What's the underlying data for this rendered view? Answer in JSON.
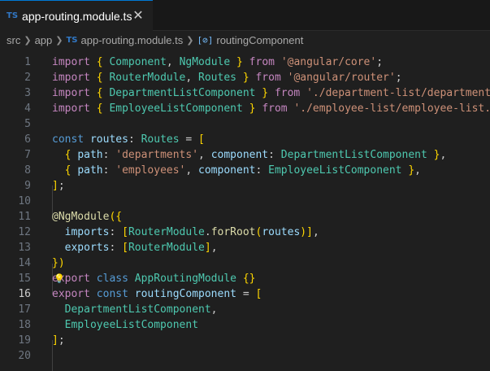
{
  "tab": {
    "badge": "TS",
    "title": "app-routing.module.ts",
    "close": "✕"
  },
  "breadcrumb": {
    "items": [
      "src",
      "app",
      "app-routing.module.ts",
      "routingComponent"
    ],
    "file_badge": "TS",
    "symbol_icon": "[⊘]"
  },
  "editor": {
    "active_line": 16,
    "line_numbers": [
      "1",
      "2",
      "3",
      "4",
      "5",
      "6",
      "7",
      "8",
      "9",
      "10",
      "11",
      "12",
      "13",
      "14",
      "15",
      "16",
      "17",
      "18",
      "19",
      "20"
    ],
    "lines": [
      "import { Component, NgModule } from '@angular/core';",
      "import { RouterModule, Routes } from '@angular/router';",
      "import { DepartmentListComponent } from './department-list/department-",
      "import { EmployeeListComponent } from './employee-list/employee-list.c",
      "",
      "const routes: Routes = [",
      "  { path: 'departments', component: DepartmentListComponent },",
      "  { path: 'employees', component: EmployeeListComponent },",
      "];",
      "",
      "@NgModule({",
      "  imports: [RouterModule.forRoot(routes)],",
      "  exports: [RouterModule],",
      "})",
      "export class AppRoutingModule {}",
      "export const routingComponent = [",
      "  DepartmentListComponent,",
      "  EmployeeListComponent",
      "];",
      ""
    ]
  },
  "colors": {
    "background": "#1f1f1f",
    "keyword": "#569cd6",
    "control_keyword": "#c586c0",
    "type": "#4ec9b0",
    "variable": "#9cdcfe",
    "string": "#ce9178",
    "function": "#dcdcaa"
  },
  "icons": {
    "lightbulb": "lightbulb-icon",
    "file_type": "typescript-icon",
    "symbol": "variable-symbol-icon"
  }
}
